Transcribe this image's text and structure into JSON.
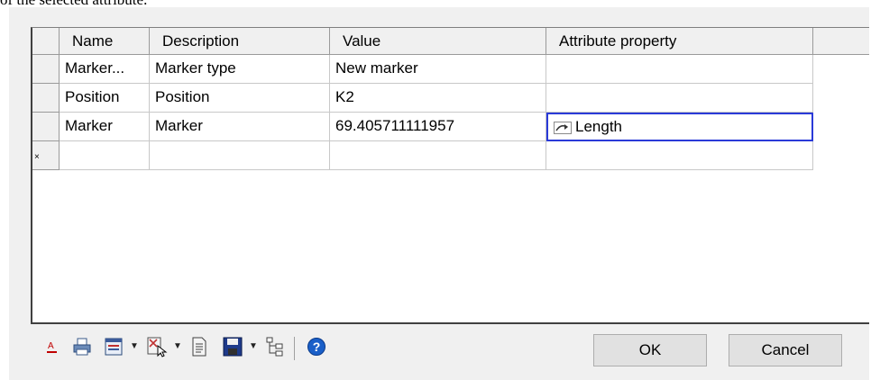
{
  "caption": "of the selected attribute.",
  "grid": {
    "columns": [
      "Name",
      "Description",
      "Value",
      "Attribute property"
    ],
    "rows": [
      {
        "name": "Marker...",
        "description": "Marker type",
        "value": "New marker",
        "property": ""
      },
      {
        "name": "Position",
        "description": "Position",
        "value": "K2",
        "property": ""
      },
      {
        "name": "Marker",
        "description": "Marker",
        "value": "69.405711111957",
        "property": "Length"
      }
    ],
    "new_row_marker": "×"
  },
  "toolbar": {
    "icons": [
      "font-color-icon",
      "print-icon",
      "table-layout-icon",
      "select-column-icon",
      "document-icon",
      "save-icon",
      "tree-view-icon",
      "help-icon"
    ]
  },
  "buttons": {
    "ok": "OK",
    "cancel": "Cancel"
  },
  "colors": {
    "selection_border": "#2a3ad8",
    "help_blue": "#1a5fc8"
  }
}
